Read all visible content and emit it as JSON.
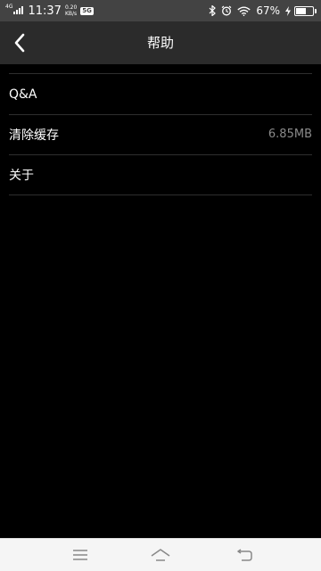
{
  "status_bar": {
    "network_type": "4G",
    "time": "11:37",
    "net_speed_value": "0.20",
    "net_speed_unit": "KB/s",
    "notification_badge": "5G",
    "battery_percent": "67%",
    "battery_level": 0.67
  },
  "header": {
    "title": "帮助"
  },
  "settings": {
    "items": [
      {
        "label": "Q&A",
        "value": ""
      },
      {
        "label": "清除缓存",
        "value": "6.85MB"
      },
      {
        "label": "关于",
        "value": ""
      }
    ]
  },
  "nav_bar": {
    "icons": [
      "menu-icon",
      "home-icon",
      "back-icon"
    ]
  },
  "colors": {
    "status_bar_bg": "#434343",
    "title_bar_bg": "#2b2b2b",
    "page_bg": "#000000",
    "divider": "#2e2e2e",
    "secondary_text": "#8a8a8a",
    "nav_bar_bg": "#f5f5f5"
  }
}
